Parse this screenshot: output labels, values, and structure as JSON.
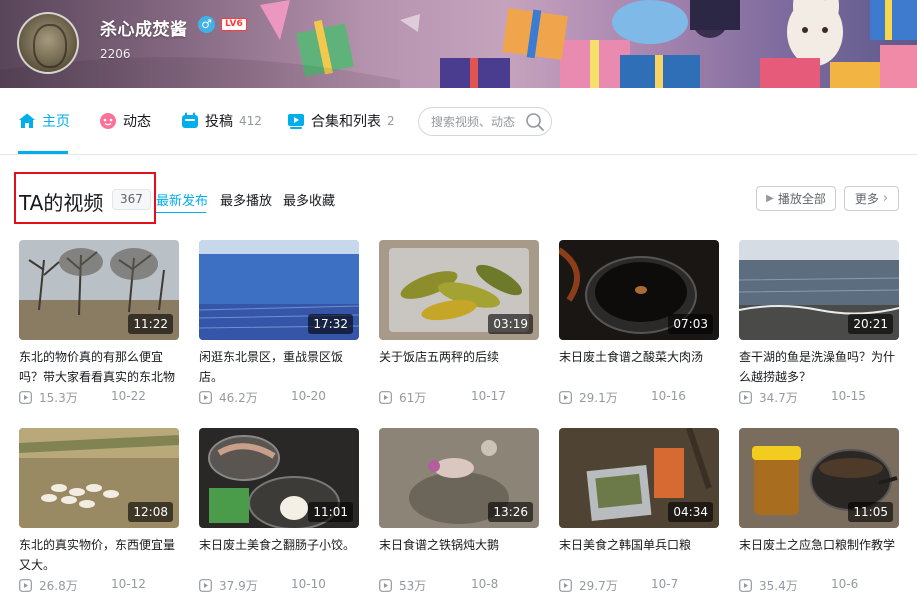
{
  "user": {
    "name": "杀心成焚酱",
    "gender_icon": "male-icon",
    "level": "LV6",
    "fans": "2206"
  },
  "nav": {
    "items": [
      {
        "label": "主页",
        "icon": "home-icon",
        "count": ""
      },
      {
        "label": "动态",
        "icon": "dynamic-icon",
        "count": ""
      },
      {
        "label": "投稿",
        "icon": "upload-icon",
        "count": "412"
      },
      {
        "label": "合集和列表",
        "icon": "collection-icon",
        "count": "2"
      }
    ],
    "search_placeholder": "搜索视频、动态"
  },
  "section": {
    "title": "TA的视频",
    "count": "367",
    "sort_tabs": [
      "最新发布",
      "最多播放",
      "最多收藏"
    ],
    "play_all": "播放全部",
    "more": "更多"
  },
  "colors": {
    "accent": "#00aeec",
    "highlight_box": "#e50f1c",
    "level_badge": "#ff3b3b",
    "gender": "#3fb3e8"
  },
  "videos": [
    {
      "title": "东北的物价真的有那么便宜吗？带大家看看真实的东北物",
      "duration": "11:22",
      "views": "15.3万",
      "date": "10-22"
    },
    {
      "title": "闲逛东北景区，重战景区饭店。",
      "duration": "17:32",
      "views": "46.2万",
      "date": "10-20"
    },
    {
      "title": "关于饭店五两秤的后续",
      "duration": "03:19",
      "views": "61万",
      "date": "10-17"
    },
    {
      "title": "末日废土食谱之酸菜大肉汤",
      "duration": "07:03",
      "views": "29.1万",
      "date": "10-16"
    },
    {
      "title": "查干湖的鱼是洗澡鱼吗？为什么越捞越多？",
      "duration": "20:21",
      "views": "34.7万",
      "date": "10-15"
    },
    {
      "title": "东北的真实物价，东西便宜量又大。",
      "duration": "12:08",
      "views": "26.8万",
      "date": "10-12"
    },
    {
      "title": "末日废土美食之翻肠子小饺。",
      "duration": "11:01",
      "views": "37.9万",
      "date": "10-10"
    },
    {
      "title": "末日食谱之铁锅炖大鹅",
      "duration": "13:26",
      "views": "53万",
      "date": "10-8"
    },
    {
      "title": "末日美食之韩国单兵口粮",
      "duration": "04:34",
      "views": "29.7万",
      "date": "10-7"
    },
    {
      "title": "末日废土之应急口粮制作教学",
      "duration": "11:05",
      "views": "35.4万",
      "date": "10-6"
    }
  ]
}
